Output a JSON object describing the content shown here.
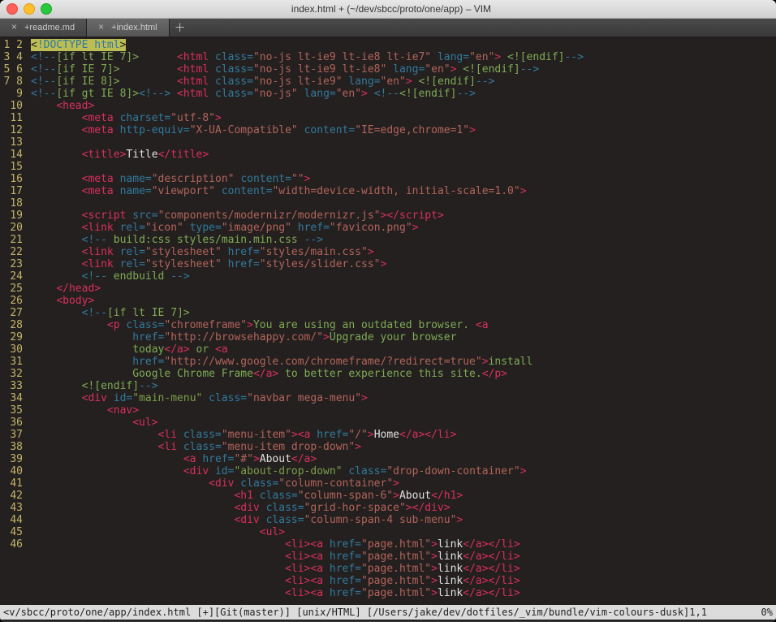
{
  "window": {
    "title": "index.html + (~/dev/sbcc/proto/one/app) – VIM"
  },
  "tabs": [
    {
      "label": "+readme.md",
      "active": false
    },
    {
      "label": "+index.html",
      "active": true
    }
  ],
  "statusbar": {
    "left": "<v/sbcc/proto/one/app/index.html [+][Git(master)] [unix/HTML] [/Users/jake/dev/dotfiles/_vim/bundle/vim-colours-dusk]1,1",
    "right": "0%"
  },
  "lines": [
    {
      "n": 1,
      "tokens": [
        [
          "cursor",
          "<"
        ],
        [
          "doctype",
          "!DOCTYPE html"
        ],
        [
          "cursor",
          ">"
        ]
      ]
    },
    {
      "n": 2,
      "tokens": [
        [
          "bang",
          "<!--"
        ],
        [
          "cmt",
          "[if lt IE 7]>      "
        ],
        [
          "tag",
          "<html "
        ],
        [
          "attr",
          "class="
        ],
        [
          "str",
          "\"no-js lt-ie9 lt-ie8 lt-ie7\" "
        ],
        [
          "attr",
          "lang="
        ],
        [
          "str",
          "\"en\""
        ],
        [
          "tag",
          ">"
        ],
        [
          "cmt",
          " <![endif]"
        ],
        [
          "bang",
          "-->"
        ]
      ]
    },
    {
      "n": 3,
      "tokens": [
        [
          "bang",
          "<!--"
        ],
        [
          "cmt",
          "[if IE 7]>         "
        ],
        [
          "tag",
          "<html "
        ],
        [
          "attr",
          "class="
        ],
        [
          "str",
          "\"no-js lt-ie9 lt-ie8\" "
        ],
        [
          "attr",
          "lang="
        ],
        [
          "str",
          "\"en\""
        ],
        [
          "tag",
          ">"
        ],
        [
          "cmt",
          " <![endif]"
        ],
        [
          "bang",
          "-->"
        ]
      ]
    },
    {
      "n": 4,
      "tokens": [
        [
          "bang",
          "<!--"
        ],
        [
          "cmt",
          "[if IE 8]>         "
        ],
        [
          "tag",
          "<html "
        ],
        [
          "attr",
          "class="
        ],
        [
          "str",
          "\"no-js lt-ie9\" "
        ],
        [
          "attr",
          "lang="
        ],
        [
          "str",
          "\"en\""
        ],
        [
          "tag",
          ">"
        ],
        [
          "cmt",
          " <![endif]"
        ],
        [
          "bang",
          "-->"
        ]
      ]
    },
    {
      "n": 5,
      "tokens": [
        [
          "bang",
          "<!--"
        ],
        [
          "cmt",
          "[if gt IE 8]>"
        ],
        [
          "bang",
          "<!--> "
        ],
        [
          "tag",
          "<html "
        ],
        [
          "attr",
          "class="
        ],
        [
          "str",
          "\"no-js\" "
        ],
        [
          "attr",
          "lang="
        ],
        [
          "str",
          "\"en\""
        ],
        [
          "tag",
          ">"
        ],
        [
          "cmt",
          " "
        ],
        [
          "bang",
          "<!--"
        ],
        [
          "cmt",
          "<![endif]"
        ],
        [
          "bang",
          "-->"
        ]
      ]
    },
    {
      "n": 6,
      "tokens": [
        [
          "punct",
          "    "
        ],
        [
          "tag",
          "<head>"
        ]
      ]
    },
    {
      "n": 7,
      "tokens": [
        [
          "punct",
          "        "
        ],
        [
          "tag",
          "<meta "
        ],
        [
          "attr",
          "charset="
        ],
        [
          "str",
          "\"utf-8\""
        ],
        [
          "tag",
          ">"
        ]
      ]
    },
    {
      "n": 8,
      "tokens": [
        [
          "punct",
          "        "
        ],
        [
          "tag",
          "<meta "
        ],
        [
          "attr",
          "http-equiv="
        ],
        [
          "str",
          "\"X-UA-Compatible\" "
        ],
        [
          "attr",
          "content="
        ],
        [
          "str",
          "\"IE=edge,chrome=1\""
        ],
        [
          "tag",
          ">"
        ]
      ]
    },
    {
      "n": 9,
      "tokens": [
        [
          "punct",
          " "
        ]
      ]
    },
    {
      "n": 10,
      "tokens": [
        [
          "punct",
          "        "
        ],
        [
          "tag",
          "<title>"
        ],
        [
          "txt",
          "Title"
        ],
        [
          "tag",
          "</title>"
        ]
      ]
    },
    {
      "n": 11,
      "tokens": [
        [
          "punct",
          " "
        ]
      ]
    },
    {
      "n": 12,
      "tokens": [
        [
          "punct",
          "        "
        ],
        [
          "tag",
          "<meta "
        ],
        [
          "attr",
          "name="
        ],
        [
          "str",
          "\"description\" "
        ],
        [
          "attr",
          "content="
        ],
        [
          "str",
          "\"\""
        ],
        [
          "tag",
          ">"
        ]
      ]
    },
    {
      "n": 13,
      "tokens": [
        [
          "punct",
          "        "
        ],
        [
          "tag",
          "<meta "
        ],
        [
          "attr",
          "name="
        ],
        [
          "str",
          "\"viewport\" "
        ],
        [
          "attr",
          "content="
        ],
        [
          "str",
          "\"width=device-width, initial-scale=1.0\""
        ],
        [
          "tag",
          ">"
        ]
      ]
    },
    {
      "n": 14,
      "tokens": [
        [
          "punct",
          " "
        ]
      ]
    },
    {
      "n": 15,
      "tokens": [
        [
          "punct",
          "        "
        ],
        [
          "tag",
          "<script "
        ],
        [
          "attr",
          "src="
        ],
        [
          "str",
          "\"components/modernizr/modernizr.js\""
        ],
        [
          "tag",
          "></script>"
        ]
      ]
    },
    {
      "n": 16,
      "tokens": [
        [
          "punct",
          "        "
        ],
        [
          "tag",
          "<link "
        ],
        [
          "attr",
          "rel="
        ],
        [
          "str",
          "\"icon\" "
        ],
        [
          "attr",
          "type="
        ],
        [
          "str",
          "\"image/png\" "
        ],
        [
          "attr",
          "href="
        ],
        [
          "str",
          "\"favicon.png\""
        ],
        [
          "tag",
          ">"
        ]
      ]
    },
    {
      "n": 17,
      "tokens": [
        [
          "punct",
          "        "
        ],
        [
          "bang",
          "<!--"
        ],
        [
          "cmt",
          " build:css styles/main.min.css "
        ],
        [
          "bang",
          "-->"
        ]
      ]
    },
    {
      "n": 18,
      "tokens": [
        [
          "punct",
          "        "
        ],
        [
          "tag",
          "<link "
        ],
        [
          "attr",
          "rel="
        ],
        [
          "str",
          "\"stylesheet\" "
        ],
        [
          "attr",
          "href="
        ],
        [
          "str",
          "\"styles/main.css\""
        ],
        [
          "tag",
          ">"
        ]
      ]
    },
    {
      "n": 19,
      "tokens": [
        [
          "punct",
          "        "
        ],
        [
          "tag",
          "<link "
        ],
        [
          "attr",
          "rel="
        ],
        [
          "str",
          "\"stylesheet\" "
        ],
        [
          "attr",
          "href="
        ],
        [
          "str",
          "\"styles/slider.css\""
        ],
        [
          "tag",
          ">"
        ]
      ]
    },
    {
      "n": 20,
      "tokens": [
        [
          "punct",
          "        "
        ],
        [
          "bang",
          "<!--"
        ],
        [
          "cmt",
          " endbuild "
        ],
        [
          "bang",
          "-->"
        ]
      ]
    },
    {
      "n": 21,
      "tokens": [
        [
          "punct",
          "    "
        ],
        [
          "tag",
          "</head>"
        ]
      ]
    },
    {
      "n": 22,
      "tokens": [
        [
          "punct",
          "    "
        ],
        [
          "tag",
          "<body>"
        ]
      ]
    },
    {
      "n": 23,
      "tokens": [
        [
          "punct",
          "        "
        ],
        [
          "bang",
          "<!--"
        ],
        [
          "cmt",
          "[if lt IE 7]>"
        ]
      ]
    },
    {
      "n": 24,
      "tokens": [
        [
          "cmt",
          "            "
        ],
        [
          "tag",
          "<p "
        ],
        [
          "attr",
          "class="
        ],
        [
          "str",
          "\"chromeframe\""
        ],
        [
          "tag",
          ">"
        ],
        [
          "cmt",
          "You are using an outdated browser. "
        ],
        [
          "tag",
          "<a"
        ]
      ]
    },
    {
      "n": 25,
      "tokens": [
        [
          "cmt",
          "                "
        ],
        [
          "attr",
          "href="
        ],
        [
          "str",
          "\"http://browsehappy.com/\""
        ],
        [
          "tag",
          ">"
        ],
        [
          "cmt",
          "Upgrade your browser"
        ]
      ]
    },
    {
      "n": 26,
      "tokens": [
        [
          "cmt",
          "                today"
        ],
        [
          "tag",
          "</a>"
        ],
        [
          "cmt",
          " or "
        ],
        [
          "tag",
          "<a"
        ]
      ]
    },
    {
      "n": 27,
      "tokens": [
        [
          "cmt",
          "                "
        ],
        [
          "attr",
          "href="
        ],
        [
          "str",
          "\"http://www.google.com/chromeframe/?redirect=true\""
        ],
        [
          "tag",
          ">"
        ],
        [
          "cmt",
          "install"
        ]
      ]
    },
    {
      "n": 28,
      "tokens": [
        [
          "cmt",
          "                Google Chrome Frame"
        ],
        [
          "tag",
          "</a>"
        ],
        [
          "cmt",
          " to better experience this site."
        ],
        [
          "tag",
          "</p>"
        ]
      ]
    },
    {
      "n": 29,
      "tokens": [
        [
          "punct",
          "        "
        ],
        [
          "cmt",
          "<![endif]"
        ],
        [
          "bang",
          "-->"
        ]
      ]
    },
    {
      "n": 30,
      "tokens": [
        [
          "punct",
          "        "
        ],
        [
          "tag",
          "<div "
        ],
        [
          "attr",
          "id="
        ],
        [
          "id",
          "\"main-menu\" "
        ],
        [
          "attr",
          "class="
        ],
        [
          "str",
          "\"navbar mega-menu\""
        ],
        [
          "tag",
          ">"
        ]
      ]
    },
    {
      "n": 31,
      "tokens": [
        [
          "punct",
          "            "
        ],
        [
          "tag",
          "<nav>"
        ]
      ]
    },
    {
      "n": 32,
      "tokens": [
        [
          "punct",
          "                "
        ],
        [
          "tag",
          "<ul>"
        ]
      ]
    },
    {
      "n": 33,
      "tokens": [
        [
          "punct",
          "                    "
        ],
        [
          "tag",
          "<li "
        ],
        [
          "attr",
          "class="
        ],
        [
          "str",
          "\"menu-item\""
        ],
        [
          "tag",
          "><a "
        ],
        [
          "attr",
          "href="
        ],
        [
          "str",
          "\"/\""
        ],
        [
          "tag",
          ">"
        ],
        [
          "txt",
          "Home"
        ],
        [
          "tag",
          "</a></li>"
        ]
      ]
    },
    {
      "n": 34,
      "tokens": [
        [
          "punct",
          "                    "
        ],
        [
          "tag",
          "<li "
        ],
        [
          "attr",
          "class="
        ],
        [
          "str",
          "\"menu-item drop-down\""
        ],
        [
          "tag",
          ">"
        ]
      ]
    },
    {
      "n": 35,
      "tokens": [
        [
          "punct",
          "                        "
        ],
        [
          "tag",
          "<a "
        ],
        [
          "attr",
          "href="
        ],
        [
          "str",
          "\"#\""
        ],
        [
          "tag",
          ">"
        ],
        [
          "txt",
          "About"
        ],
        [
          "tag",
          "</a>"
        ]
      ]
    },
    {
      "n": 36,
      "tokens": [
        [
          "punct",
          "                        "
        ],
        [
          "tag",
          "<div "
        ],
        [
          "attr",
          "id="
        ],
        [
          "id",
          "\"about-drop-down\" "
        ],
        [
          "attr",
          "class="
        ],
        [
          "str",
          "\"drop-down-container\""
        ],
        [
          "tag",
          ">"
        ]
      ]
    },
    {
      "n": 37,
      "tokens": [
        [
          "punct",
          "                            "
        ],
        [
          "tag",
          "<div "
        ],
        [
          "attr",
          "class="
        ],
        [
          "str",
          "\"column-container\""
        ],
        [
          "tag",
          ">"
        ]
      ]
    },
    {
      "n": 38,
      "tokens": [
        [
          "punct",
          "                                "
        ],
        [
          "tag",
          "<h1 "
        ],
        [
          "attr",
          "class="
        ],
        [
          "str",
          "\"column-span-6\""
        ],
        [
          "tag",
          ">"
        ],
        [
          "txt",
          "About"
        ],
        [
          "tag",
          "</h1>"
        ]
      ]
    },
    {
      "n": 39,
      "tokens": [
        [
          "punct",
          "                                "
        ],
        [
          "tag",
          "<div "
        ],
        [
          "attr",
          "class="
        ],
        [
          "str",
          "\"grid-hor-space\""
        ],
        [
          "tag",
          "></div>"
        ]
      ]
    },
    {
      "n": 40,
      "tokens": [
        [
          "punct",
          "                                "
        ],
        [
          "tag",
          "<div "
        ],
        [
          "attr",
          "class="
        ],
        [
          "str",
          "\"column-span-4 sub-menu\""
        ],
        [
          "tag",
          ">"
        ]
      ]
    },
    {
      "n": 41,
      "tokens": [
        [
          "punct",
          "                                    "
        ],
        [
          "tag",
          "<ul>"
        ]
      ]
    },
    {
      "n": 42,
      "tokens": [
        [
          "punct",
          "                                        "
        ],
        [
          "tag",
          "<li><a "
        ],
        [
          "attr",
          "href="
        ],
        [
          "str",
          "\"page.html\""
        ],
        [
          "tag",
          ">"
        ],
        [
          "txt",
          "link"
        ],
        [
          "tag",
          "</a></li>"
        ]
      ]
    },
    {
      "n": 43,
      "tokens": [
        [
          "punct",
          "                                        "
        ],
        [
          "tag",
          "<li><a "
        ],
        [
          "attr",
          "href="
        ],
        [
          "str",
          "\"page.html\""
        ],
        [
          "tag",
          ">"
        ],
        [
          "txt",
          "link"
        ],
        [
          "tag",
          "</a></li>"
        ]
      ]
    },
    {
      "n": 44,
      "tokens": [
        [
          "punct",
          "                                        "
        ],
        [
          "tag",
          "<li><a "
        ],
        [
          "attr",
          "href="
        ],
        [
          "str",
          "\"page.html\""
        ],
        [
          "tag",
          ">"
        ],
        [
          "txt",
          "link"
        ],
        [
          "tag",
          "</a></li>"
        ]
      ]
    },
    {
      "n": 45,
      "tokens": [
        [
          "punct",
          "                                        "
        ],
        [
          "tag",
          "<li><a "
        ],
        [
          "attr",
          "href="
        ],
        [
          "str",
          "\"page.html\""
        ],
        [
          "tag",
          ">"
        ],
        [
          "txt",
          "link"
        ],
        [
          "tag",
          "</a></li>"
        ]
      ]
    },
    {
      "n": 46,
      "tokens": [
        [
          "punct",
          "                                        "
        ],
        [
          "tag",
          "<li><a "
        ],
        [
          "attr",
          "href="
        ],
        [
          "str",
          "\"page.html\""
        ],
        [
          "tag",
          ">"
        ],
        [
          "txt",
          "link"
        ],
        [
          "tag",
          "</a></li>"
        ]
      ]
    }
  ]
}
